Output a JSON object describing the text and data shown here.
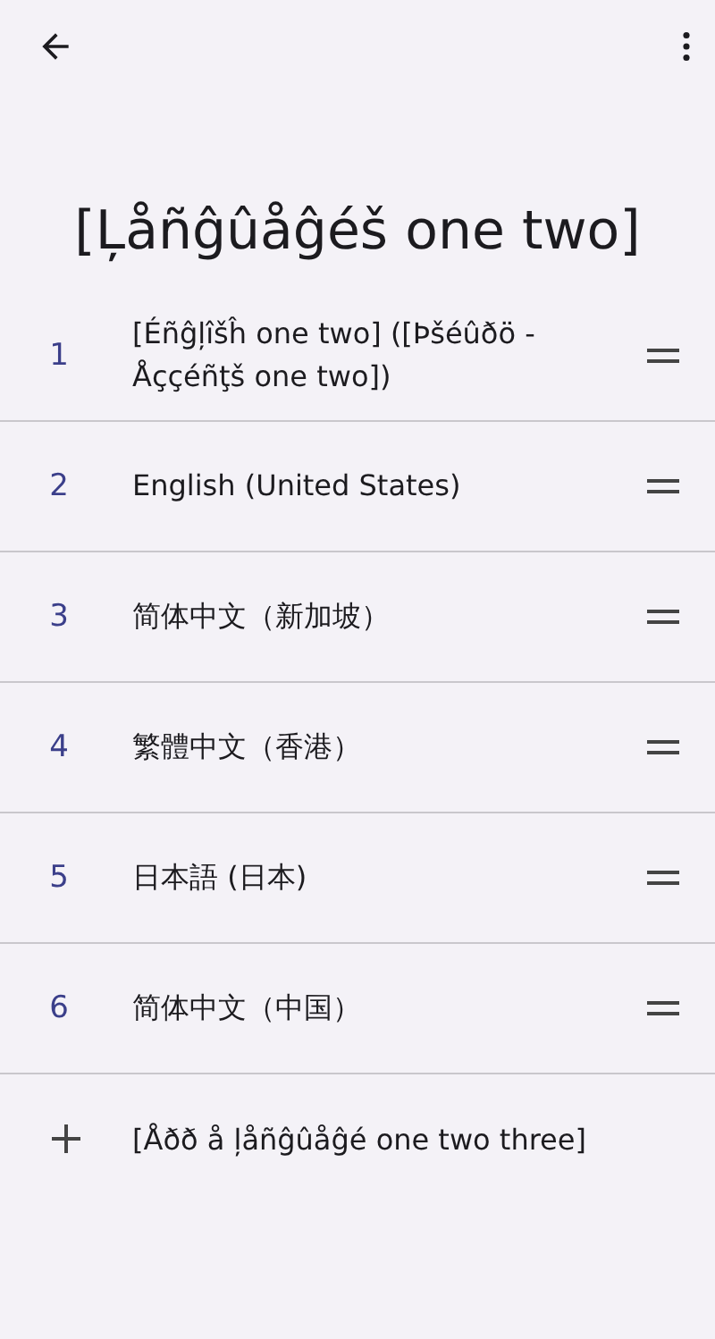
{
  "title": "[Ļåñĝûåĝéš one two]",
  "languages": [
    {
      "number": "1",
      "name": "[Éñĝļîšĥ one two] ([Þšéûðö - Åççéñţš one two])"
    },
    {
      "number": "2",
      "name": "English (United States)"
    },
    {
      "number": "3",
      "name": "简体中文（新加坡）"
    },
    {
      "number": "4",
      "name": "繁體中文（香港）"
    },
    {
      "number": "5",
      "name": "日本語 (日本)"
    },
    {
      "number": "6",
      "name": "简体中文（中国）"
    }
  ],
  "add_language": {
    "label": "[Åðð å ļåñĝûåĝé one two three]"
  }
}
